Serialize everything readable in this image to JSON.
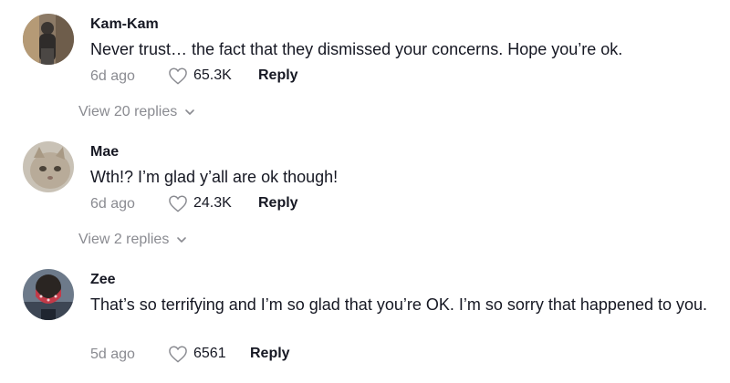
{
  "comments": [
    {
      "username": "Kam-Kam",
      "text": "Never trust… the fact that they dismissed your concerns. Hope you’re ok.",
      "time": "6d ago",
      "likes": "65.3K",
      "reply_label": "Reply",
      "view_replies": "View 20 replies"
    },
    {
      "username": "Mae",
      "text": "Wth!? I’m glad y’all are ok though!",
      "time": "6d ago",
      "likes": "24.3K",
      "reply_label": "Reply",
      "view_replies": "View 2 replies"
    },
    {
      "username": "Zee",
      "text": "That’s so terrifying and I’m so glad that you’re OK. I’m so sorry that happened to you.",
      "time": "5d ago",
      "likes": "6561",
      "reply_label": "Reply"
    }
  ],
  "colors": {
    "text": "#161823",
    "muted": "#8a8b91",
    "background": "#ffffff"
  },
  "icons": {
    "like": "heart-outline-icon",
    "expand": "chevron-down-icon"
  }
}
